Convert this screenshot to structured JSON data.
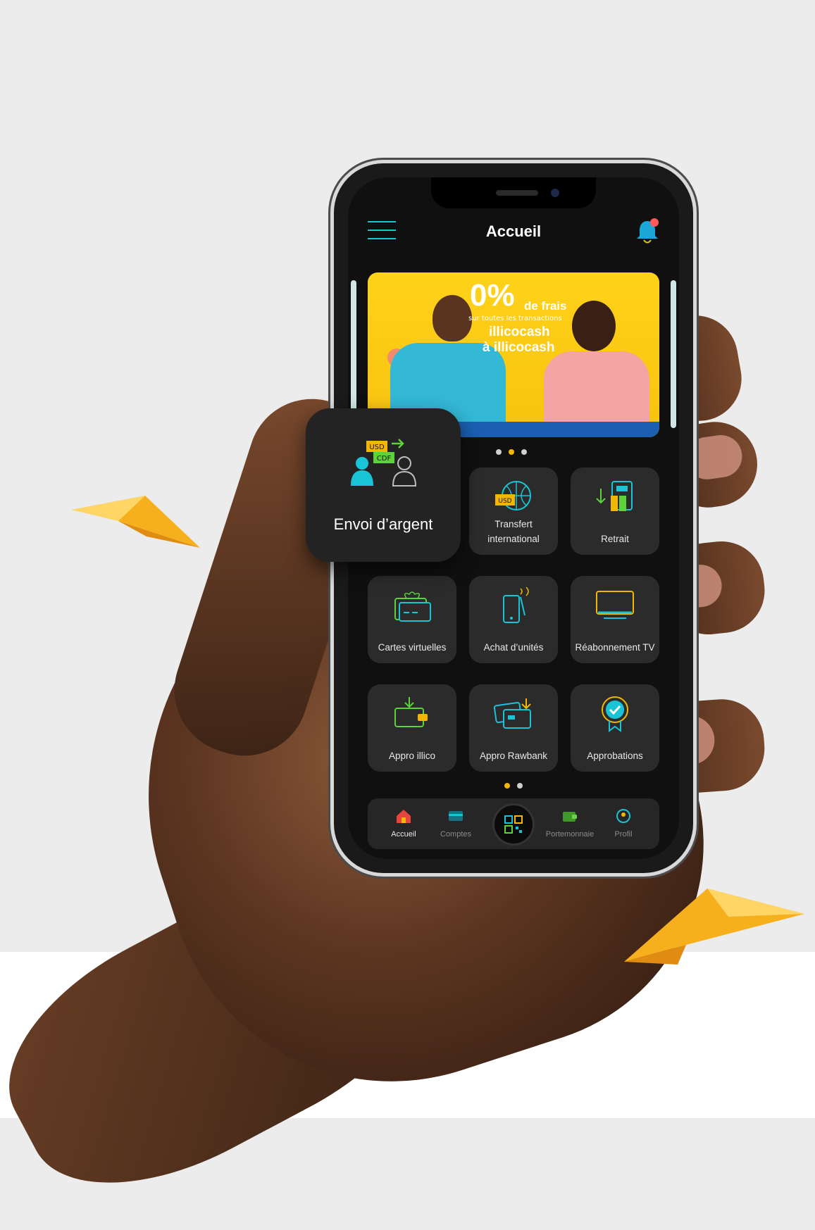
{
  "header": {
    "title": "Accueil",
    "menu_icon": "menu-icon",
    "bell_icon": "notification-bell-icon"
  },
  "banner": {
    "percent": "0%",
    "frais": "de frais",
    "subtitle": "sur toutes les transactions",
    "line1": "illicocash",
    "line2": "à illicocash",
    "carousel_dots": 3,
    "active_dot": 2
  },
  "featured": {
    "label": "Envoi d’argent",
    "icon": "money-transfer-icon"
  },
  "services": [
    {
      "label": "Transfert international",
      "icon": "international-transfer-icon"
    },
    {
      "label": "Retrait",
      "icon": "withdrawal-icon"
    },
    {
      "label": "Cartes virtuelles",
      "icon": "virtual-card-icon"
    },
    {
      "label": "Achat d’unités",
      "icon": "airtime-icon"
    },
    {
      "label": "Réabonnement TV",
      "icon": "tv-icon"
    },
    {
      "label": "Appro illico",
      "icon": "wallet-topup-icon"
    },
    {
      "label": "Appro Rawbank",
      "icon": "bank-topup-icon"
    },
    {
      "label": "Approbations",
      "icon": "approval-badge-icon"
    }
  ],
  "grid_dots": {
    "count": 2,
    "active": 1
  },
  "tabbar": [
    {
      "label": "Accueil",
      "icon": "home-icon",
      "active": true
    },
    {
      "label": "Comptes",
      "icon": "accounts-icon",
      "active": false
    },
    {
      "label": "",
      "icon": "qr-code-icon",
      "active": false
    },
    {
      "label": "Portemonnaie",
      "icon": "wallet-icon",
      "active": false
    },
    {
      "label": "Profil",
      "icon": "profile-icon",
      "active": false
    }
  ],
  "colors": {
    "accent_yellow": "#f2b705",
    "accent_cyan": "#19c4d6",
    "accent_green": "#5ed13b",
    "tile_bg": "#2b2b2b",
    "screen_bg": "#101010"
  }
}
